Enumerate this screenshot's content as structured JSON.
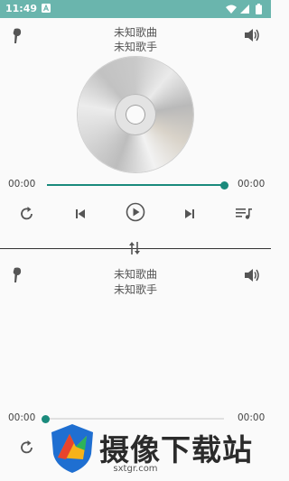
{
  "status_bar": {
    "time": "11:49",
    "app_icon": "a-icon",
    "icons": [
      "wifi-icon",
      "signal-icon",
      "battery-icon"
    ]
  },
  "player_top": {
    "song_title": "未知歌曲",
    "artist": "未知歌手",
    "current_time": "00:00",
    "total_time": "00:00",
    "progress": 1.0,
    "icons": [
      "earphone-icon",
      "volume-icon",
      "repeat-icon",
      "previous-icon",
      "play-icon",
      "next-icon",
      "playlist-icon"
    ]
  },
  "swap_icon": "swap-vertical-icon",
  "player_bottom": {
    "song_title": "未知歌曲",
    "artist": "未知歌手",
    "current_time": "00:00",
    "total_time": "00:00",
    "progress": 0.0,
    "icons": [
      "earphone-icon",
      "volume-icon",
      "repeat-icon"
    ]
  },
  "watermark": {
    "text": "摄像下载站",
    "url": "sxtgr.com"
  },
  "colors": {
    "accent": "#1a8a7c",
    "status_bar": "#6ab5ad",
    "background": "#fafafa"
  }
}
